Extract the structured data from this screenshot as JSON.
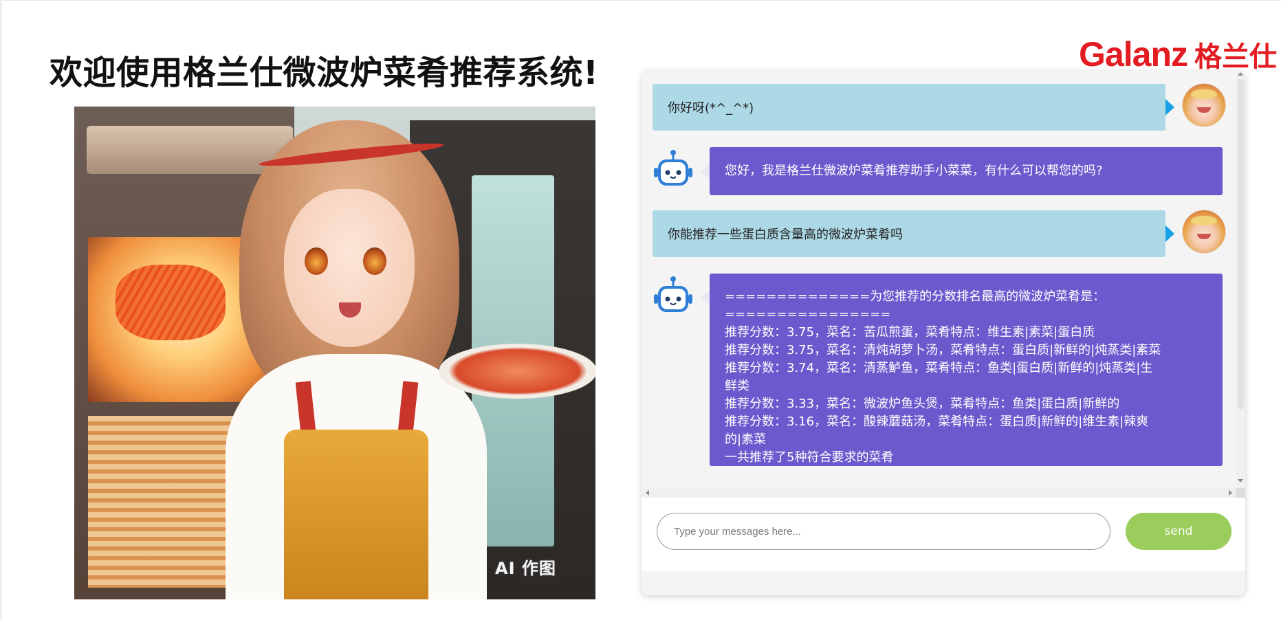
{
  "page": {
    "title": "欢迎使用格兰仕微波炉菜肴推荐系统!"
  },
  "logo": {
    "word": "Galanz",
    "chinese": "格兰仕"
  },
  "illustration": {
    "tag": "AI 作图"
  },
  "chat": {
    "messages": [
      {
        "role": "user",
        "text": "你好呀(*^_^*)"
      },
      {
        "role": "bot",
        "lines": [
          "您好，我是格兰仕微波炉菜肴推荐助手小菜菜，有什么可以帮您的吗?"
        ]
      },
      {
        "role": "user",
        "text": "你能推荐一些蛋白质含量高的微波炉菜肴吗"
      },
      {
        "role": "bot",
        "lines": [
          "==============为您推荐的分数排名最高的微波炉菜肴是：================",
          "推荐分数：3.75，菜名：苦瓜煎蛋，菜肴特点：维生素|素菜|蛋白质",
          "推荐分数：3.75，菜名：清炖胡萝卜汤，菜肴特点：蛋白质|新鲜的|炖蒸类|素菜",
          "推荐分数：3.74，菜名：清蒸鲈鱼，菜肴特点：鱼类|蛋白质|新鲜的|炖蒸类|生",
          "鲜类",
          "推荐分数：3.33，菜名：微波炉鱼头煲，菜肴特点：鱼类|蛋白质|新鲜的",
          "推荐分数：3.16，菜名：酸辣蘑菇汤，菜肴特点：蛋白质|新鲜的|维生素|辣爽",
          "的|素菜",
          "一共推荐了5种符合要求的菜肴"
        ]
      }
    ]
  },
  "input": {
    "value": "",
    "placeholder": "Type your messages here..."
  },
  "send": {
    "label": "send"
  },
  "colors": {
    "user_bubble": "#add8e6",
    "bot_bubble": "#6a5acd",
    "send_button": "#9acd5b",
    "brand": "#e21c21"
  }
}
